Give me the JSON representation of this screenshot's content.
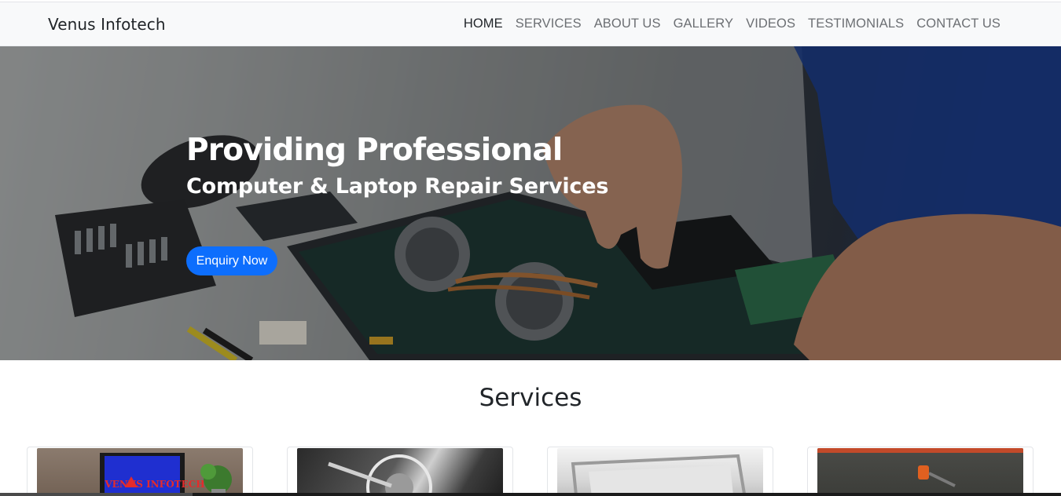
{
  "navbar": {
    "brand": "Venus Infotech",
    "items": [
      {
        "label": "HOME",
        "active": true
      },
      {
        "label": "SERVICES",
        "active": false
      },
      {
        "label": "ABOUT US",
        "active": false
      },
      {
        "label": "GALLERY",
        "active": false
      },
      {
        "label": "VIDEOS",
        "active": false
      },
      {
        "label": "TESTIMONIALS",
        "active": false
      },
      {
        "label": "CONTACT US",
        "active": false
      }
    ]
  },
  "hero": {
    "title": "Providing Professional",
    "subtitle": "Computer & Laptop Repair Services",
    "button_label": "Enquiry Now"
  },
  "services": {
    "heading": "Services",
    "cards": [
      {
        "image_text": "VENUS INFOTECH"
      },
      {
        "image_text": ""
      },
      {
        "image_text": ""
      },
      {
        "image_text": ""
      }
    ]
  },
  "colors": {
    "primary": "#0d6efd",
    "navbar_bg": "#f8f9fa",
    "text_dark": "#212529",
    "nav_muted": "#6c6f73"
  }
}
